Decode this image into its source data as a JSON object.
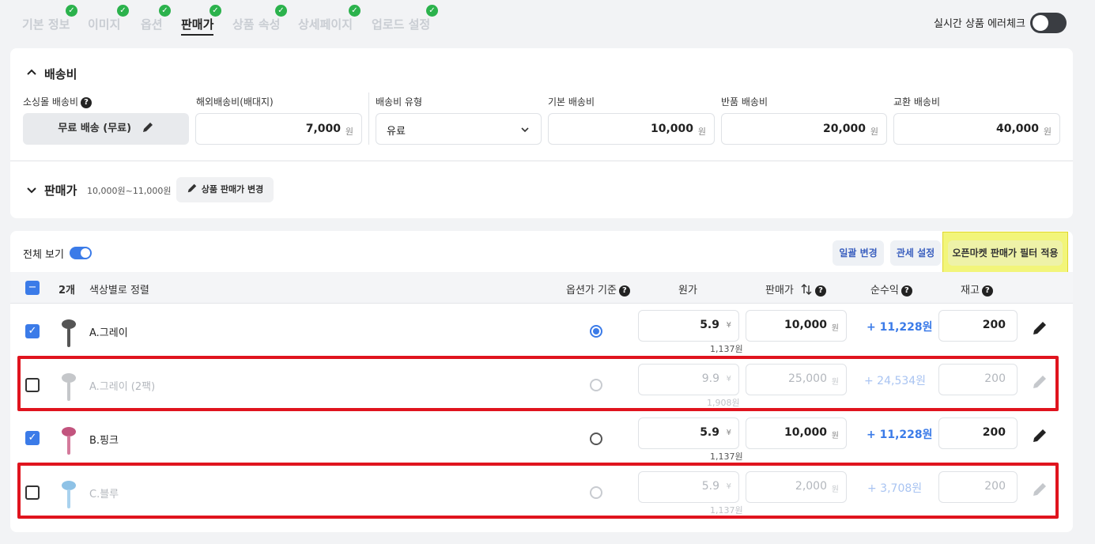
{
  "tabs": [
    {
      "label": "기본 정보",
      "done": true
    },
    {
      "label": "이미지",
      "done": true
    },
    {
      "label": "옵션",
      "done": true
    },
    {
      "label": "판매가",
      "done": true,
      "active": true
    },
    {
      "label": "상품 속성",
      "done": true
    },
    {
      "label": "상세페이지",
      "done": true
    },
    {
      "label": "업로드 설정",
      "done": true
    }
  ],
  "error_check": {
    "label": "실시간 상품 에러체크",
    "enabled": false
  },
  "shipping": {
    "title": "배송비",
    "mall_label": "소싱몰 배송비",
    "mall_button": "무료 배송 (무료)",
    "overseas_label": "해외배송비(배대지)",
    "overseas_value": "7,000",
    "type_label": "배송비 유형",
    "type_value": "유료",
    "base_label": "기본 배송비",
    "base_value": "10,000",
    "return_label": "반품 배송비",
    "return_value": "20,000",
    "exchange_label": "교환 배송비",
    "exchange_value": "40,000",
    "unit": "원"
  },
  "price": {
    "title": "판매가",
    "range": "10,000원~11,000원",
    "change_button": "상품 판매가 변경"
  },
  "table": {
    "view_all_label": "전체 보기",
    "bulk_button": "일괄 변경",
    "customs_button": "관세 설정",
    "filter_button": "오픈마켓 판매가 필터 적용",
    "count": "2개",
    "sort_label": "색상별로 정렬",
    "col_option_price": "옵션가 기준",
    "col_cost": "원가",
    "col_sale": "판매가",
    "col_profit": "순수익",
    "col_stock": "재고",
    "rows": [
      {
        "name": "A.그레이",
        "checked": true,
        "selected": true,
        "cost": "5.9",
        "cost_unit": "¥",
        "cost_krw": "1,137원",
        "sale": "10,000",
        "sale_unit": "원",
        "profit": "+ 11,228원",
        "stock": "200",
        "color": "#555"
      },
      {
        "name": "A.그레이 (2팩)",
        "checked": false,
        "selected": false,
        "cost": "9.9",
        "cost_unit": "¥",
        "cost_krw": "1,908원",
        "sale": "25,000",
        "sale_unit": "원",
        "profit": "+ 24,534원",
        "stock": "200",
        "color": "#999"
      },
      {
        "name": "B.핑크",
        "checked": true,
        "selected": false,
        "cost": "5.9",
        "cost_unit": "¥",
        "cost_krw": "1,137원",
        "sale": "10,000",
        "sale_unit": "원",
        "profit": "+ 11,228원",
        "stock": "200",
        "color": "#c2547e"
      },
      {
        "name": "C.블루",
        "checked": false,
        "selected": false,
        "cost": "5.9",
        "cost_unit": "¥",
        "cost_krw": "1,137원",
        "sale": "2,000",
        "sale_unit": "원",
        "profit": "+ 3,708원",
        "stock": "200",
        "color": "#8ec2e6"
      }
    ]
  },
  "colors": {
    "accent": "#3b7be8",
    "check_green": "#2bb24c",
    "highlight": "#f2f57a",
    "alert_red": "#e0141e"
  }
}
